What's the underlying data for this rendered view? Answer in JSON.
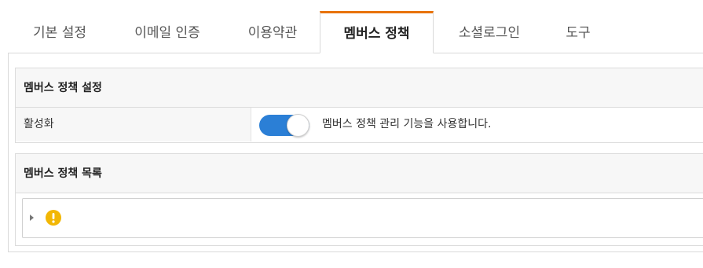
{
  "tabs": [
    {
      "label": "기본 설정",
      "active": false
    },
    {
      "label": "이메일 인증",
      "active": false
    },
    {
      "label": "이용약관",
      "active": false
    },
    {
      "label": "멤버스 정책",
      "active": true
    },
    {
      "label": "소셜로그인",
      "active": false
    },
    {
      "label": "도구",
      "active": false
    }
  ],
  "settings_card": {
    "title": "멤버스 정책 설정",
    "activation": {
      "label": "활성화",
      "enabled": true,
      "description": "멤버스 정책 관리 기능을 사용합니다."
    }
  },
  "list_card": {
    "title": "멤버스 정책 목록",
    "tree": {
      "expander_icon": "caret-right-icon",
      "status_icon": "warning-icon"
    }
  },
  "colors": {
    "accent_tab": "#e8730c",
    "toggle_on": "#2b7fd6",
    "warning": "#f2b705"
  }
}
